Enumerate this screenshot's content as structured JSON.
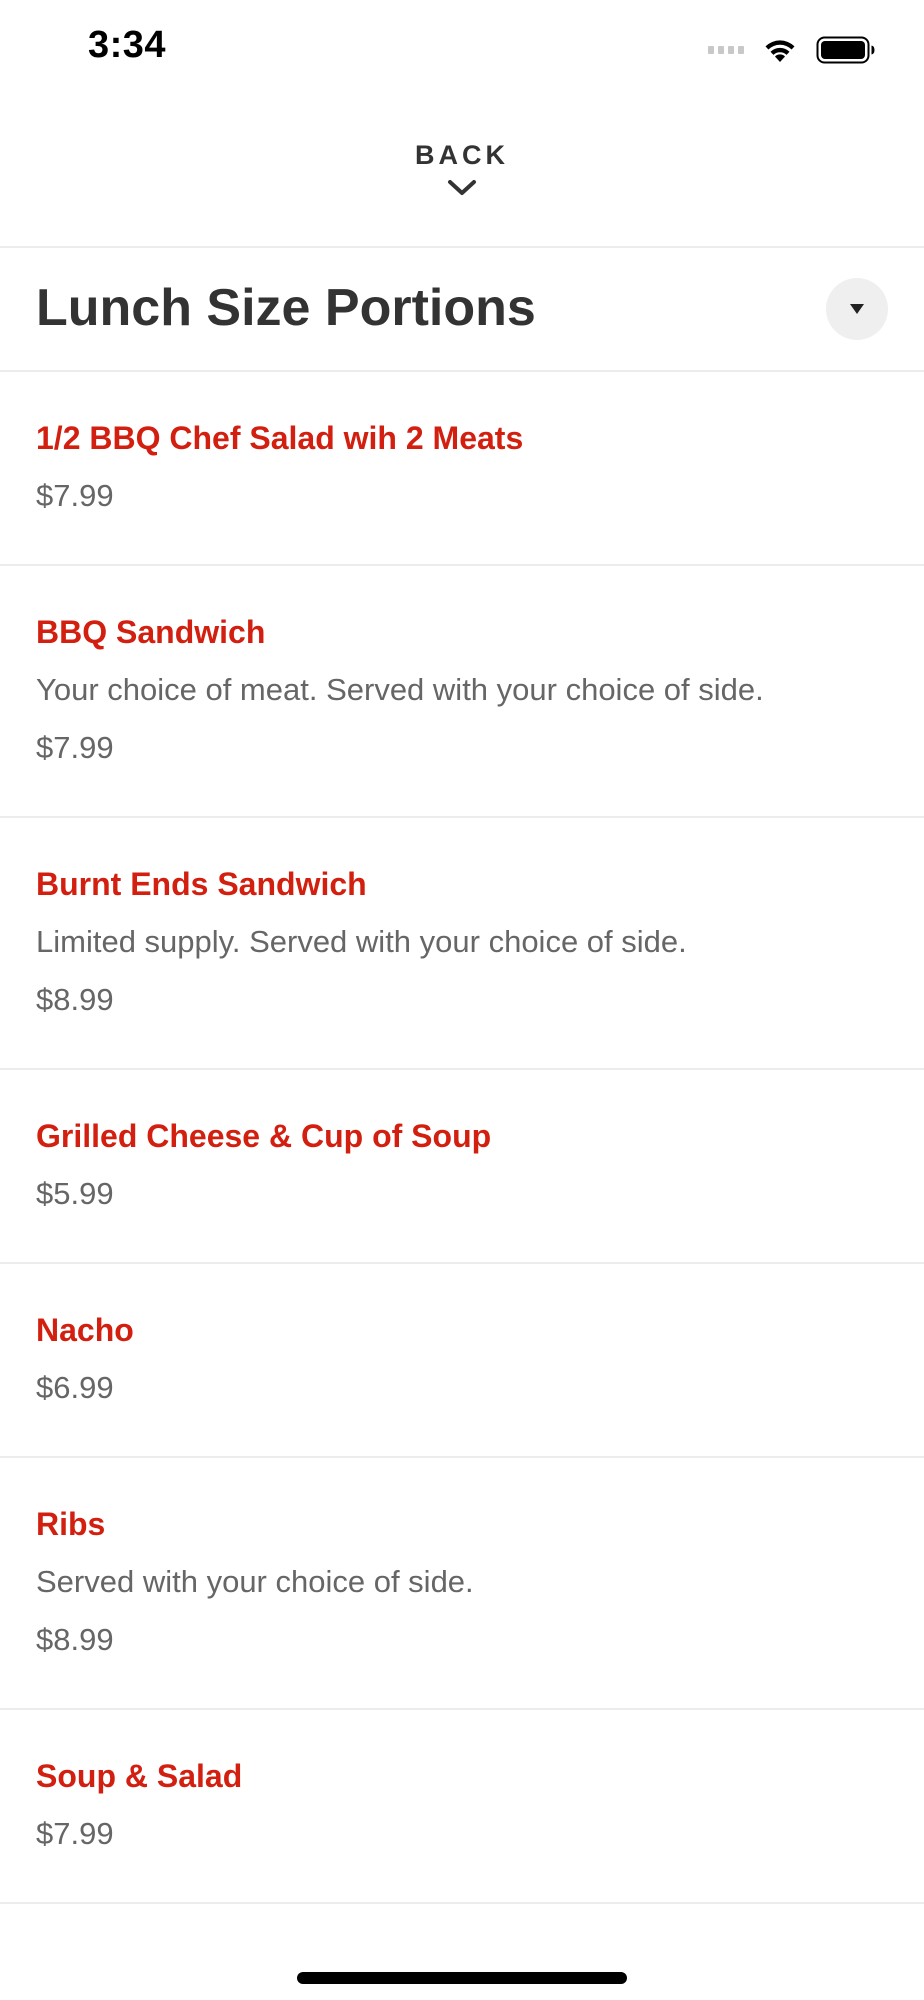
{
  "status_bar": {
    "time": "3:34"
  },
  "nav": {
    "back_label": "BACK"
  },
  "section": {
    "title": "Lunch Size Portions"
  },
  "menu_items": [
    {
      "name": "1/2 BBQ Chef Salad wih 2 Meats",
      "description": "",
      "price": "$7.99"
    },
    {
      "name": "BBQ Sandwich",
      "description": "Your choice of meat. Served with your choice of side.",
      "price": "$7.99"
    },
    {
      "name": "Burnt Ends Sandwich",
      "description": "Limited supply. Served with your choice of side.",
      "price": "$8.99"
    },
    {
      "name": "Grilled Cheese & Cup of Soup",
      "description": "",
      "price": "$5.99"
    },
    {
      "name": "Nacho",
      "description": "",
      "price": "$6.99"
    },
    {
      "name": "Ribs",
      "description": "Served with your choice of side.",
      "price": "$8.99"
    },
    {
      "name": "Soup & Salad",
      "description": "",
      "price": "$7.99"
    }
  ],
  "colors": {
    "item_name": "#d21f0f",
    "text_secondary": "#666666",
    "title": "#333333"
  },
  "icons": {
    "back": "chevron-down-icon",
    "collapse": "caret-down-icon",
    "wifi": "wifi-icon",
    "battery": "battery-icon",
    "signal": "signal-icon"
  }
}
